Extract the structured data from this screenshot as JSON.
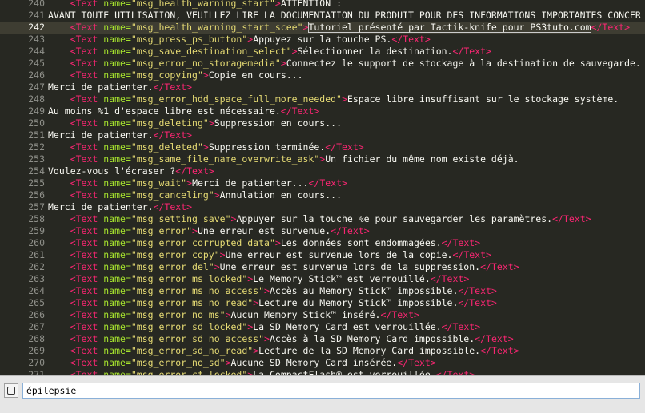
{
  "editor": {
    "current_line": "242",
    "lines": [
      {
        "n": "240",
        "indent": "    ",
        "parts": [
          [
            "tag",
            "<Text "
          ],
          [
            "attr",
            "name="
          ],
          [
            "str",
            "\"msg_health_warning_start\""
          ],
          [
            "tag",
            ">"
          ],
          [
            "txt",
            "ATTENTION :"
          ]
        ]
      },
      {
        "n": "241",
        "indent": "",
        "parts": [
          [
            "txt",
            "AVANT TOUTE UTILISATION, VEUILLEZ LIRE LA DOCUMENTATION DU PRODUIT POUR DES INFORMATIONS IMPORTANTES CONCER"
          ]
        ]
      },
      {
        "n": "242",
        "indent": "    ",
        "parts": [
          [
            "tag",
            "<Text "
          ],
          [
            "attr",
            "name="
          ],
          [
            "str",
            "\"msg_health_warning_start_scee\""
          ],
          [
            "tag",
            ">"
          ],
          [
            "hl",
            "Tutoriel présenté par Tactik-knife pour PS3tuto.com"
          ],
          [
            "tag",
            "</Text>"
          ]
        ]
      },
      {
        "n": "243",
        "indent": "    ",
        "parts": [
          [
            "tag",
            "<Text "
          ],
          [
            "attr",
            "name="
          ],
          [
            "str",
            "\"msg_press_ps_button\""
          ],
          [
            "tag",
            ">"
          ],
          [
            "txt",
            "Appuyez sur la touche PS."
          ],
          [
            "tag",
            "</Text>"
          ]
        ]
      },
      {
        "n": "244",
        "indent": "    ",
        "parts": [
          [
            "tag",
            "<Text "
          ],
          [
            "attr",
            "name="
          ],
          [
            "str",
            "\"msg_save_destination_select\""
          ],
          [
            "tag",
            ">"
          ],
          [
            "txt",
            "Sélectionner la destination."
          ],
          [
            "tag",
            "</Text>"
          ]
        ]
      },
      {
        "n": "245",
        "indent": "    ",
        "parts": [
          [
            "tag",
            "<Text "
          ],
          [
            "attr",
            "name="
          ],
          [
            "str",
            "\"msg_error_no_storagemedia\""
          ],
          [
            "tag",
            ">"
          ],
          [
            "txt",
            "Connectez le support de stockage à la destination de sauvegarde."
          ]
        ]
      },
      {
        "n": "246",
        "indent": "    ",
        "parts": [
          [
            "tag",
            "<Text "
          ],
          [
            "attr",
            "name="
          ],
          [
            "str",
            "\"msg_copying\""
          ],
          [
            "tag",
            ">"
          ],
          [
            "txt",
            "Copie en cours..."
          ]
        ]
      },
      {
        "n": "247",
        "indent": "",
        "parts": [
          [
            "txt",
            "Merci de patienter."
          ],
          [
            "tag",
            "</Text>"
          ]
        ]
      },
      {
        "n": "248",
        "indent": "    ",
        "parts": [
          [
            "tag",
            "<Text "
          ],
          [
            "attr",
            "name="
          ],
          [
            "str",
            "\"msg_error_hdd_space_full_more_needed\""
          ],
          [
            "tag",
            ">"
          ],
          [
            "txt",
            "Espace libre insuffisant sur le stockage système."
          ]
        ]
      },
      {
        "n": "249",
        "indent": "",
        "parts": [
          [
            "txt",
            "Au moins %1 d'espace libre est nécessaire."
          ],
          [
            "tag",
            "</Text>"
          ]
        ]
      },
      {
        "n": "250",
        "indent": "    ",
        "parts": [
          [
            "tag",
            "<Text "
          ],
          [
            "attr",
            "name="
          ],
          [
            "str",
            "\"msg_deleting\""
          ],
          [
            "tag",
            ">"
          ],
          [
            "txt",
            "Suppression en cours..."
          ]
        ]
      },
      {
        "n": "251",
        "indent": "",
        "parts": [
          [
            "txt",
            "Merci de patienter."
          ],
          [
            "tag",
            "</Text>"
          ]
        ]
      },
      {
        "n": "252",
        "indent": "    ",
        "parts": [
          [
            "tag",
            "<Text "
          ],
          [
            "attr",
            "name="
          ],
          [
            "str",
            "\"msg_deleted\""
          ],
          [
            "tag",
            ">"
          ],
          [
            "txt",
            "Suppression terminée."
          ],
          [
            "tag",
            "</Text>"
          ]
        ]
      },
      {
        "n": "253",
        "indent": "    ",
        "parts": [
          [
            "tag",
            "<Text "
          ],
          [
            "attr",
            "name="
          ],
          [
            "str",
            "\"msg_same_file_name_overwrite_ask\""
          ],
          [
            "tag",
            ">"
          ],
          [
            "txt",
            "Un fichier du même nom existe déjà."
          ]
        ]
      },
      {
        "n": "254",
        "indent": "",
        "parts": [
          [
            "txt",
            "Voulez-vous l'écraser ?"
          ],
          [
            "tag",
            "</Text>"
          ]
        ]
      },
      {
        "n": "255",
        "indent": "    ",
        "parts": [
          [
            "tag",
            "<Text "
          ],
          [
            "attr",
            "name="
          ],
          [
            "str",
            "\"msg_wait\""
          ],
          [
            "tag",
            ">"
          ],
          [
            "txt",
            "Merci de patienter..."
          ],
          [
            "tag",
            "</Text>"
          ]
        ]
      },
      {
        "n": "256",
        "indent": "    ",
        "parts": [
          [
            "tag",
            "<Text "
          ],
          [
            "attr",
            "name="
          ],
          [
            "str",
            "\"msg_canceling\""
          ],
          [
            "tag",
            ">"
          ],
          [
            "txt",
            "Annulation en cours..."
          ]
        ]
      },
      {
        "n": "257",
        "indent": "",
        "parts": [
          [
            "txt",
            "Merci de patienter."
          ],
          [
            "tag",
            "</Text>"
          ]
        ]
      },
      {
        "n": "258",
        "indent": "    ",
        "parts": [
          [
            "tag",
            "<Text "
          ],
          [
            "attr",
            "name="
          ],
          [
            "str",
            "\"msg_setting_save\""
          ],
          [
            "tag",
            ">"
          ],
          [
            "txt",
            "Appuyer sur la touche %e pour sauvegarder les paramètres."
          ],
          [
            "tag",
            "</Text>"
          ]
        ]
      },
      {
        "n": "259",
        "indent": "    ",
        "parts": [
          [
            "tag",
            "<Text "
          ],
          [
            "attr",
            "name="
          ],
          [
            "str",
            "\"msg_error\""
          ],
          [
            "tag",
            ">"
          ],
          [
            "txt",
            "Une erreur est survenue."
          ],
          [
            "tag",
            "</Text>"
          ]
        ]
      },
      {
        "n": "260",
        "indent": "    ",
        "parts": [
          [
            "tag",
            "<Text "
          ],
          [
            "attr",
            "name="
          ],
          [
            "str",
            "\"msg_error_corrupted_data\""
          ],
          [
            "tag",
            ">"
          ],
          [
            "txt",
            "Les données sont endommagées."
          ],
          [
            "tag",
            "</Text>"
          ]
        ]
      },
      {
        "n": "261",
        "indent": "    ",
        "parts": [
          [
            "tag",
            "<Text "
          ],
          [
            "attr",
            "name="
          ],
          [
            "str",
            "\"msg_error_copy\""
          ],
          [
            "tag",
            ">"
          ],
          [
            "txt",
            "Une erreur est survenue lors de la copie."
          ],
          [
            "tag",
            "</Text>"
          ]
        ]
      },
      {
        "n": "262",
        "indent": "    ",
        "parts": [
          [
            "tag",
            "<Text "
          ],
          [
            "attr",
            "name="
          ],
          [
            "str",
            "\"msg_error_del\""
          ],
          [
            "tag",
            ">"
          ],
          [
            "txt",
            "Une erreur est survenue lors de la suppression."
          ],
          [
            "tag",
            "</Text>"
          ]
        ]
      },
      {
        "n": "263",
        "indent": "    ",
        "parts": [
          [
            "tag",
            "<Text "
          ],
          [
            "attr",
            "name="
          ],
          [
            "str",
            "\"msg_error_ms_locked\""
          ],
          [
            "tag",
            ">"
          ],
          [
            "txt",
            "Le Memory Stick™ est verrouillé."
          ],
          [
            "tag",
            "</Text>"
          ]
        ]
      },
      {
        "n": "264",
        "indent": "    ",
        "parts": [
          [
            "tag",
            "<Text "
          ],
          [
            "attr",
            "name="
          ],
          [
            "str",
            "\"msg_error_ms_no_access\""
          ],
          [
            "tag",
            ">"
          ],
          [
            "txt",
            "Accès au Memory Stick™ impossible."
          ],
          [
            "tag",
            "</Text>"
          ]
        ]
      },
      {
        "n": "265",
        "indent": "    ",
        "parts": [
          [
            "tag",
            "<Text "
          ],
          [
            "attr",
            "name="
          ],
          [
            "str",
            "\"msg_error_ms_no_read\""
          ],
          [
            "tag",
            ">"
          ],
          [
            "txt",
            "Lecture du Memory Stick™ impossible."
          ],
          [
            "tag",
            "</Text>"
          ]
        ]
      },
      {
        "n": "266",
        "indent": "    ",
        "parts": [
          [
            "tag",
            "<Text "
          ],
          [
            "attr",
            "name="
          ],
          [
            "str",
            "\"msg_error_no_ms\""
          ],
          [
            "tag",
            ">"
          ],
          [
            "txt",
            "Aucun Memory Stick™ inséré."
          ],
          [
            "tag",
            "</Text>"
          ]
        ]
      },
      {
        "n": "267",
        "indent": "    ",
        "parts": [
          [
            "tag",
            "<Text "
          ],
          [
            "attr",
            "name="
          ],
          [
            "str",
            "\"msg_error_sd_locked\""
          ],
          [
            "tag",
            ">"
          ],
          [
            "txt",
            "La SD Memory Card est verrouillée."
          ],
          [
            "tag",
            "</Text>"
          ]
        ]
      },
      {
        "n": "268",
        "indent": "    ",
        "parts": [
          [
            "tag",
            "<Text "
          ],
          [
            "attr",
            "name="
          ],
          [
            "str",
            "\"msg_error_sd_no_access\""
          ],
          [
            "tag",
            ">"
          ],
          [
            "txt",
            "Accès à la SD Memory Card impossible."
          ],
          [
            "tag",
            "</Text>"
          ]
        ]
      },
      {
        "n": "269",
        "indent": "    ",
        "parts": [
          [
            "tag",
            "<Text "
          ],
          [
            "attr",
            "name="
          ],
          [
            "str",
            "\"msg_error_sd_no_read\""
          ],
          [
            "tag",
            ">"
          ],
          [
            "txt",
            "Lecture de la SD Memory Card impossible."
          ],
          [
            "tag",
            "</Text>"
          ]
        ]
      },
      {
        "n": "270",
        "indent": "    ",
        "parts": [
          [
            "tag",
            "<Text "
          ],
          [
            "attr",
            "name="
          ],
          [
            "str",
            "\"msg_error_no_sd\""
          ],
          [
            "tag",
            ">"
          ],
          [
            "txt",
            "Aucune SD Memory Card insérée."
          ],
          [
            "tag",
            "</Text>"
          ]
        ]
      },
      {
        "n": "271",
        "indent": "    ",
        "parts": [
          [
            "tag",
            "<Text "
          ],
          [
            "attr",
            "name="
          ],
          [
            "str",
            "\"msg_error_cf_locked\""
          ],
          [
            "tag",
            ">"
          ],
          [
            "txt",
            "La CompactFlash® est verrouillée."
          ],
          [
            "tag",
            "</Text>"
          ]
        ]
      }
    ]
  },
  "find": {
    "query": "épilepsie",
    "toggle_icon": "regex-toggle-icon"
  }
}
